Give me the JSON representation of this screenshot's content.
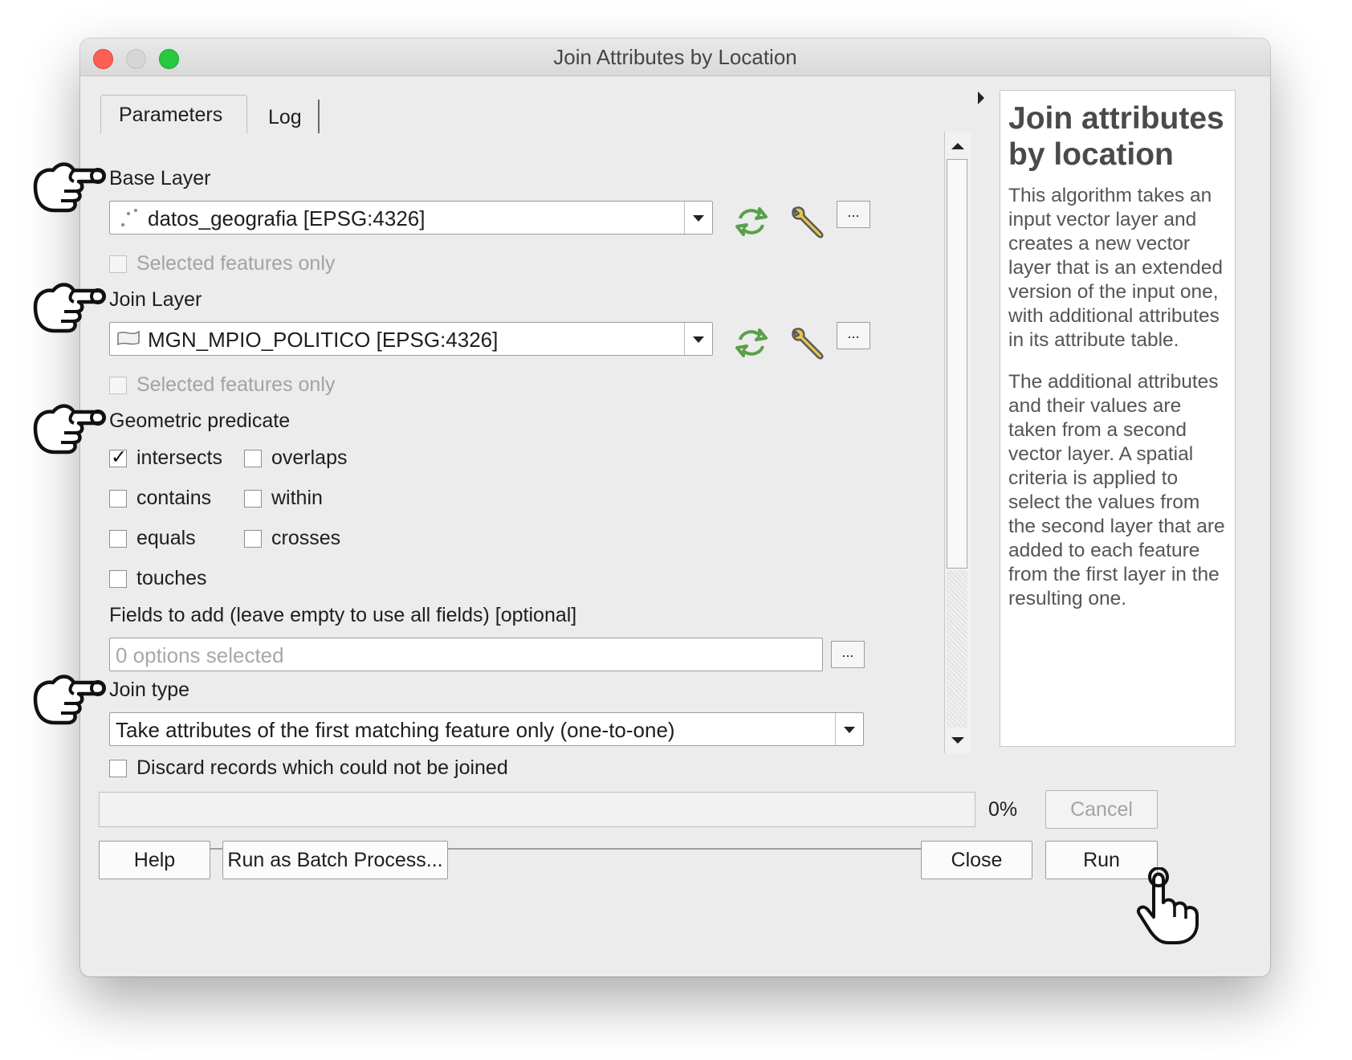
{
  "window": {
    "title": "Join Attributes by Location"
  },
  "tabs": [
    {
      "label": "Parameters"
    },
    {
      "label": "Log"
    }
  ],
  "base_layer": {
    "label": "Base Layer",
    "value": "datos_geografia [EPSG:4326]",
    "selected_only_label": "Selected features only",
    "dots_label": "..."
  },
  "join_layer": {
    "label": "Join Layer",
    "value": "MGN_MPIO_POLITICO [EPSG:4326]",
    "selected_only_label": "Selected features only",
    "dots_label": "..."
  },
  "predicate": {
    "label": "Geometric predicate",
    "options": [
      {
        "label": "intersects",
        "checked": true
      },
      {
        "label": "overlaps",
        "checked": false
      },
      {
        "label": "contains",
        "checked": false
      },
      {
        "label": "within",
        "checked": false
      },
      {
        "label": "equals",
        "checked": false
      },
      {
        "label": "crosses",
        "checked": false
      },
      {
        "label": "touches",
        "checked": false
      }
    ]
  },
  "fields": {
    "label": "Fields to add (leave empty to use all fields) [optional]",
    "placeholder": "0 options selected",
    "button_label": "..."
  },
  "join_type": {
    "label": "Join type",
    "value": "Take attributes of the first matching feature only (one-to-one)"
  },
  "discard": {
    "label": "Discard records which could not be joined",
    "checked": false
  },
  "help": {
    "title": "Join attributes by location",
    "paragraphs": [
      "This algorithm takes an input vector layer and creates a new vector layer that is an extended version of the input one, with additional attributes in its attribute table.",
      "The additional attributes and their values are taken from a second vector layer. A spatial criteria is applied to select the values from the second layer that are added to each feature from the first layer in the resulting one."
    ]
  },
  "progress": {
    "percent_label": "0%",
    "value": 0
  },
  "buttons": {
    "cancel": "Cancel",
    "help": "Help",
    "batch": "Run as Batch Process...",
    "close": "Close",
    "run": "Run"
  },
  "colors": {
    "refresh_icon": "#5aa04a",
    "window_bg": "#ececec"
  }
}
